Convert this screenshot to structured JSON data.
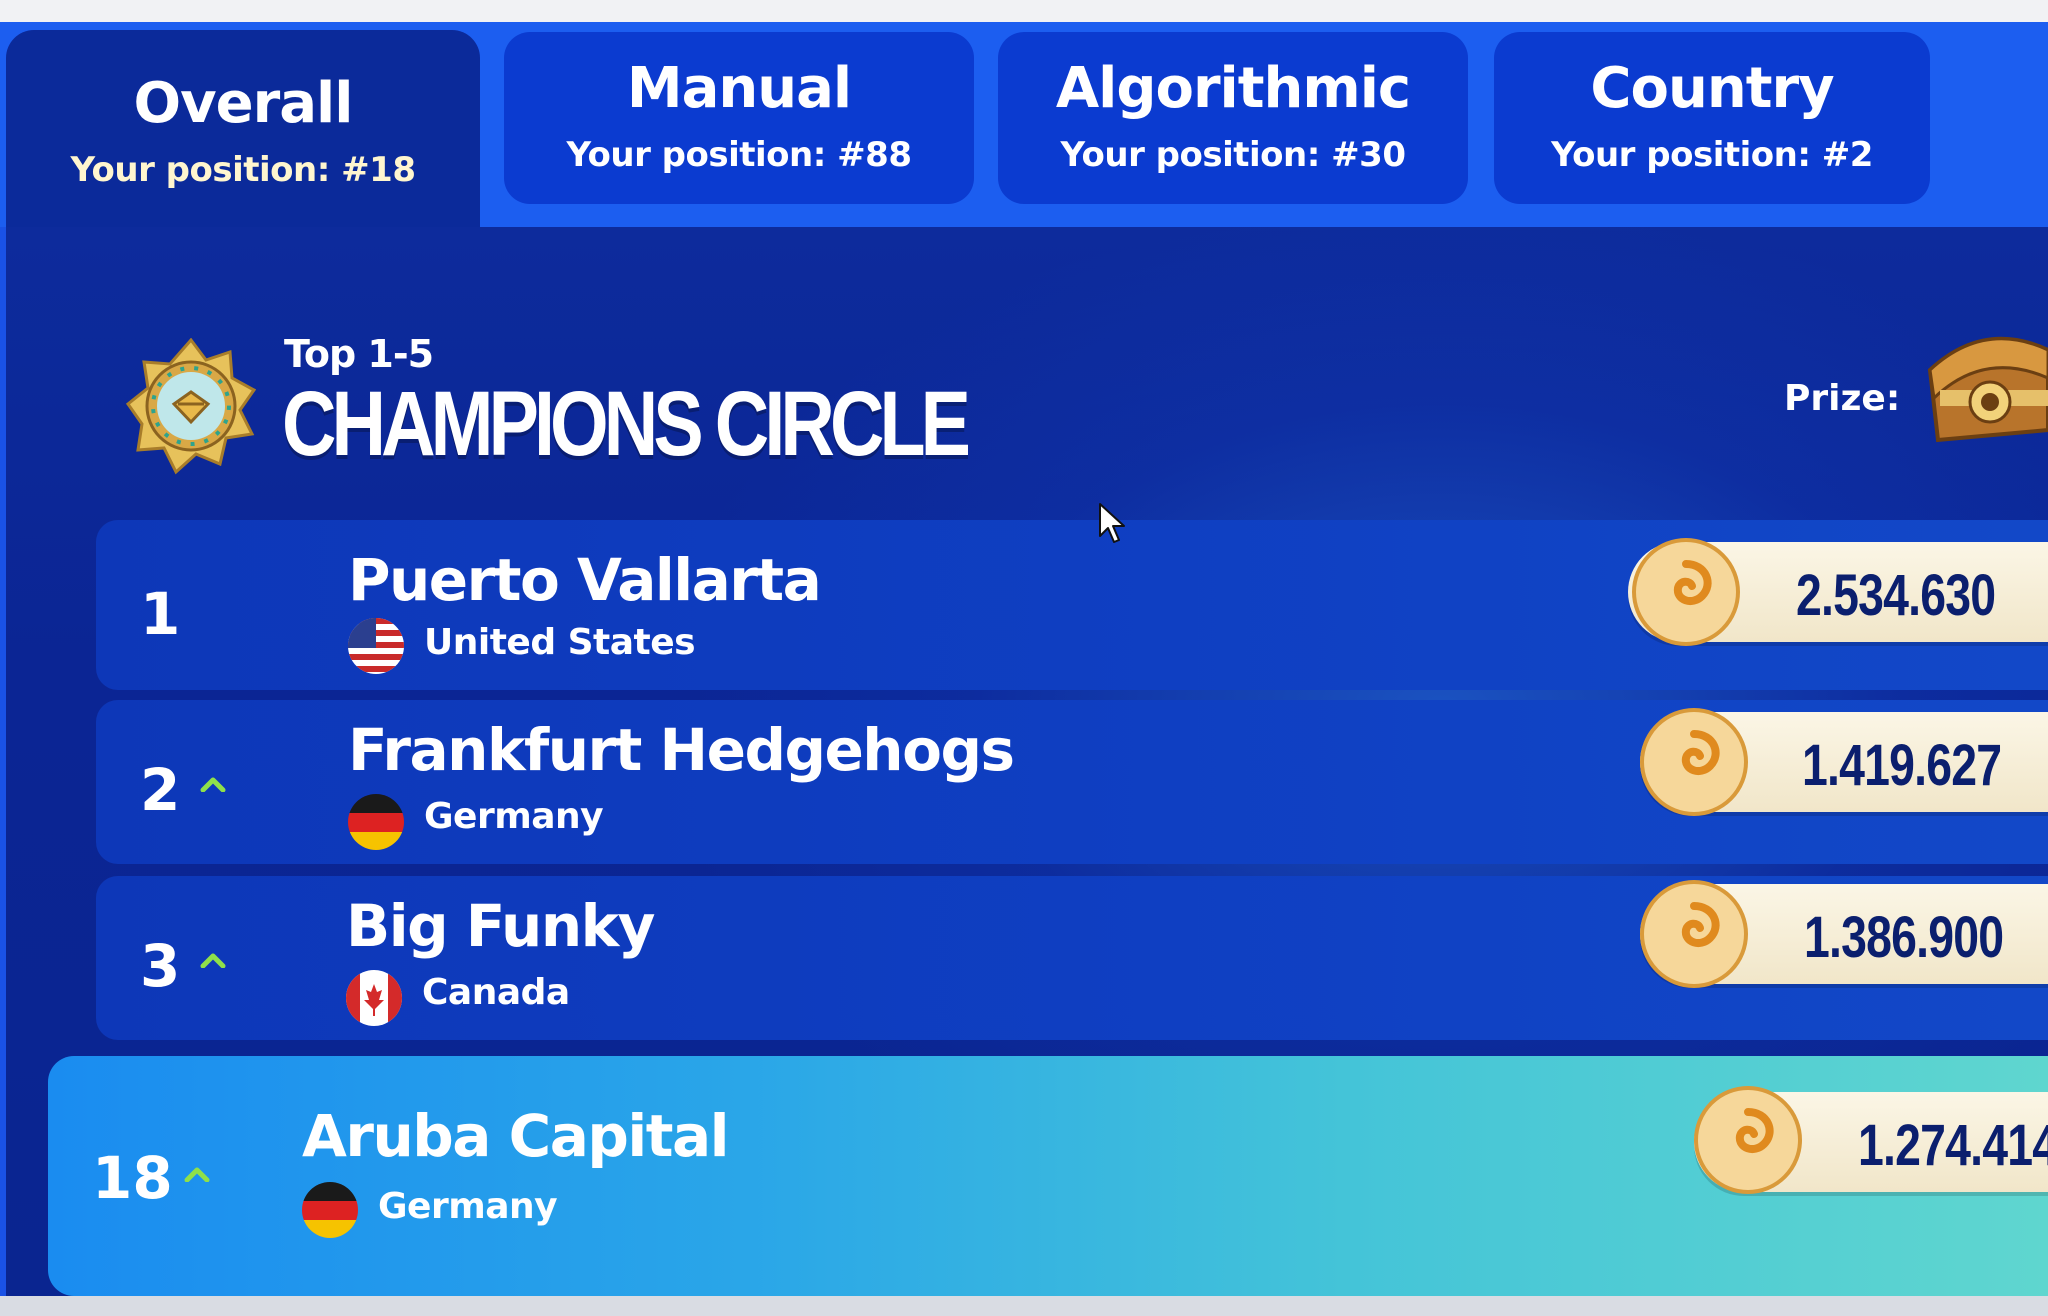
{
  "tabs": [
    {
      "title": "Overall",
      "position": "Your position: #18",
      "active": true
    },
    {
      "title": "Manual",
      "position": "Your position: #88",
      "active": false
    },
    {
      "title": "Algorithmic",
      "position": "Your position: #30",
      "active": false
    },
    {
      "title": "Country",
      "position": "Your position: #2",
      "active": false
    }
  ],
  "header": {
    "subtitle": "Top 1-5",
    "title": "CHAMPIONS CIRCLE",
    "prize_label": "Prize:",
    "badge_icon": "medal-icon",
    "prize_icon": "treasure-chest-icon"
  },
  "rows": [
    {
      "rank": "1",
      "trend": "",
      "name": "Puerto Vallarta",
      "country": "United States",
      "flag": "us-flag-icon",
      "score": "2.534.630"
    },
    {
      "rank": "2",
      "trend": "up",
      "name": "Frankfurt Hedgehogs",
      "country": "Germany",
      "flag": "de-flag-icon",
      "score": "1.419.627"
    },
    {
      "rank": "3",
      "trend": "up",
      "name": "Big Funky",
      "country": "Canada",
      "flag": "ca-flag-icon",
      "score": "1.386.900"
    }
  ],
  "my_row": {
    "rank": "18",
    "trend": "up",
    "name": "Aruba Capital",
    "country": "Germany",
    "flag": "de-flag-icon",
    "score": "1.274.414"
  },
  "colors": {
    "tab_active": "#0b2a9a",
    "tab_inactive": "#0b3bd0",
    "panel": "#0b2594",
    "score_text": "#0b1f6e",
    "trend_up": "#8fe04a",
    "highlight_start": "#1a8cf0",
    "highlight_end": "#5fd6cf"
  }
}
